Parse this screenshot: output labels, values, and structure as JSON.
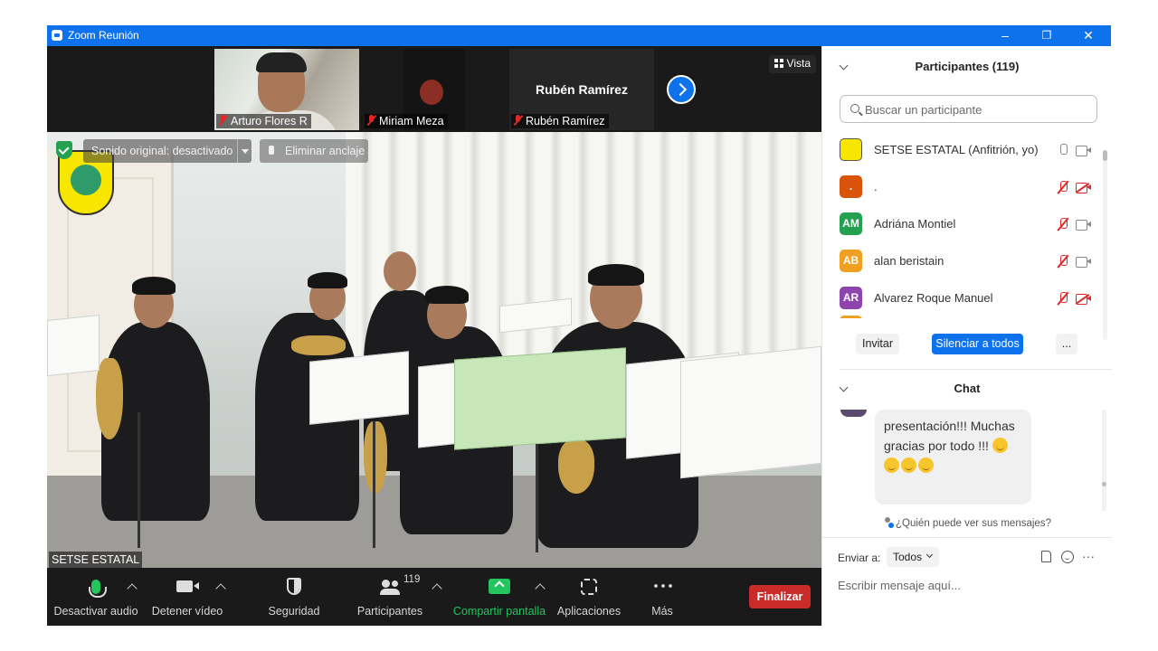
{
  "window": {
    "title": "Zoom Reunión",
    "minimize": "–",
    "restore": "❐",
    "close": "✕"
  },
  "strip": {
    "thumbnails": [
      {
        "name": "Arturo Flores R",
        "muted": true
      },
      {
        "name": "Miriam Meza",
        "muted": true
      },
      {
        "name": "Rubén Ramírez",
        "muted": true,
        "display_name": "Rubén Ramírez"
      }
    ],
    "view_label": "Vista"
  },
  "video": {
    "original_sound": "Sonido original: desactivado",
    "unpin": "Eliminar anclaje",
    "speaker_name": "SETSE ESTATAL"
  },
  "toolbar": {
    "mute": "Desactivar audio",
    "stop_video": "Detener vídeo",
    "security": "Seguridad",
    "participants": "Participantes",
    "participants_count": "119",
    "share": "Compartir pantalla",
    "apps": "Aplicaciones",
    "more": "Más",
    "end": "Finalizar"
  },
  "participants": {
    "title": "Participantes (119)",
    "search_placeholder": "Buscar un participante",
    "items": [
      {
        "initials": "",
        "name": "SETSE ESTATAL (Anfitrión, yo)",
        "color": "#f6e600",
        "mic": "on",
        "cam": "on"
      },
      {
        "initials": ".",
        "name": ".",
        "color": "#d9540a",
        "mic": "off",
        "cam": "off"
      },
      {
        "initials": "AM",
        "name": "Adriána Montiel",
        "color": "#23a150",
        "mic": "off",
        "cam": "on"
      },
      {
        "initials": "AB",
        "name": "alan beristain",
        "color": "#f0a020",
        "mic": "off",
        "cam": "on"
      },
      {
        "initials": "AR",
        "name": "Alvarez Roque Manuel",
        "color": "#8e44ad",
        "mic": "off",
        "cam": "off"
      }
    ],
    "invite": "Invitar",
    "mute_all": "Silenciar a todos",
    "more": "..."
  },
  "chat": {
    "title": "Chat",
    "message_line1": "presentación!!! Muchas",
    "message_line2": "gracias por todo !!!",
    "who_can_see": "¿Quién puede ver sus mensajes?",
    "send_to_label": "Enviar a:",
    "send_to_value": "Todos",
    "more": "···",
    "input_placeholder": "Escribir mensaje aquí..."
  }
}
